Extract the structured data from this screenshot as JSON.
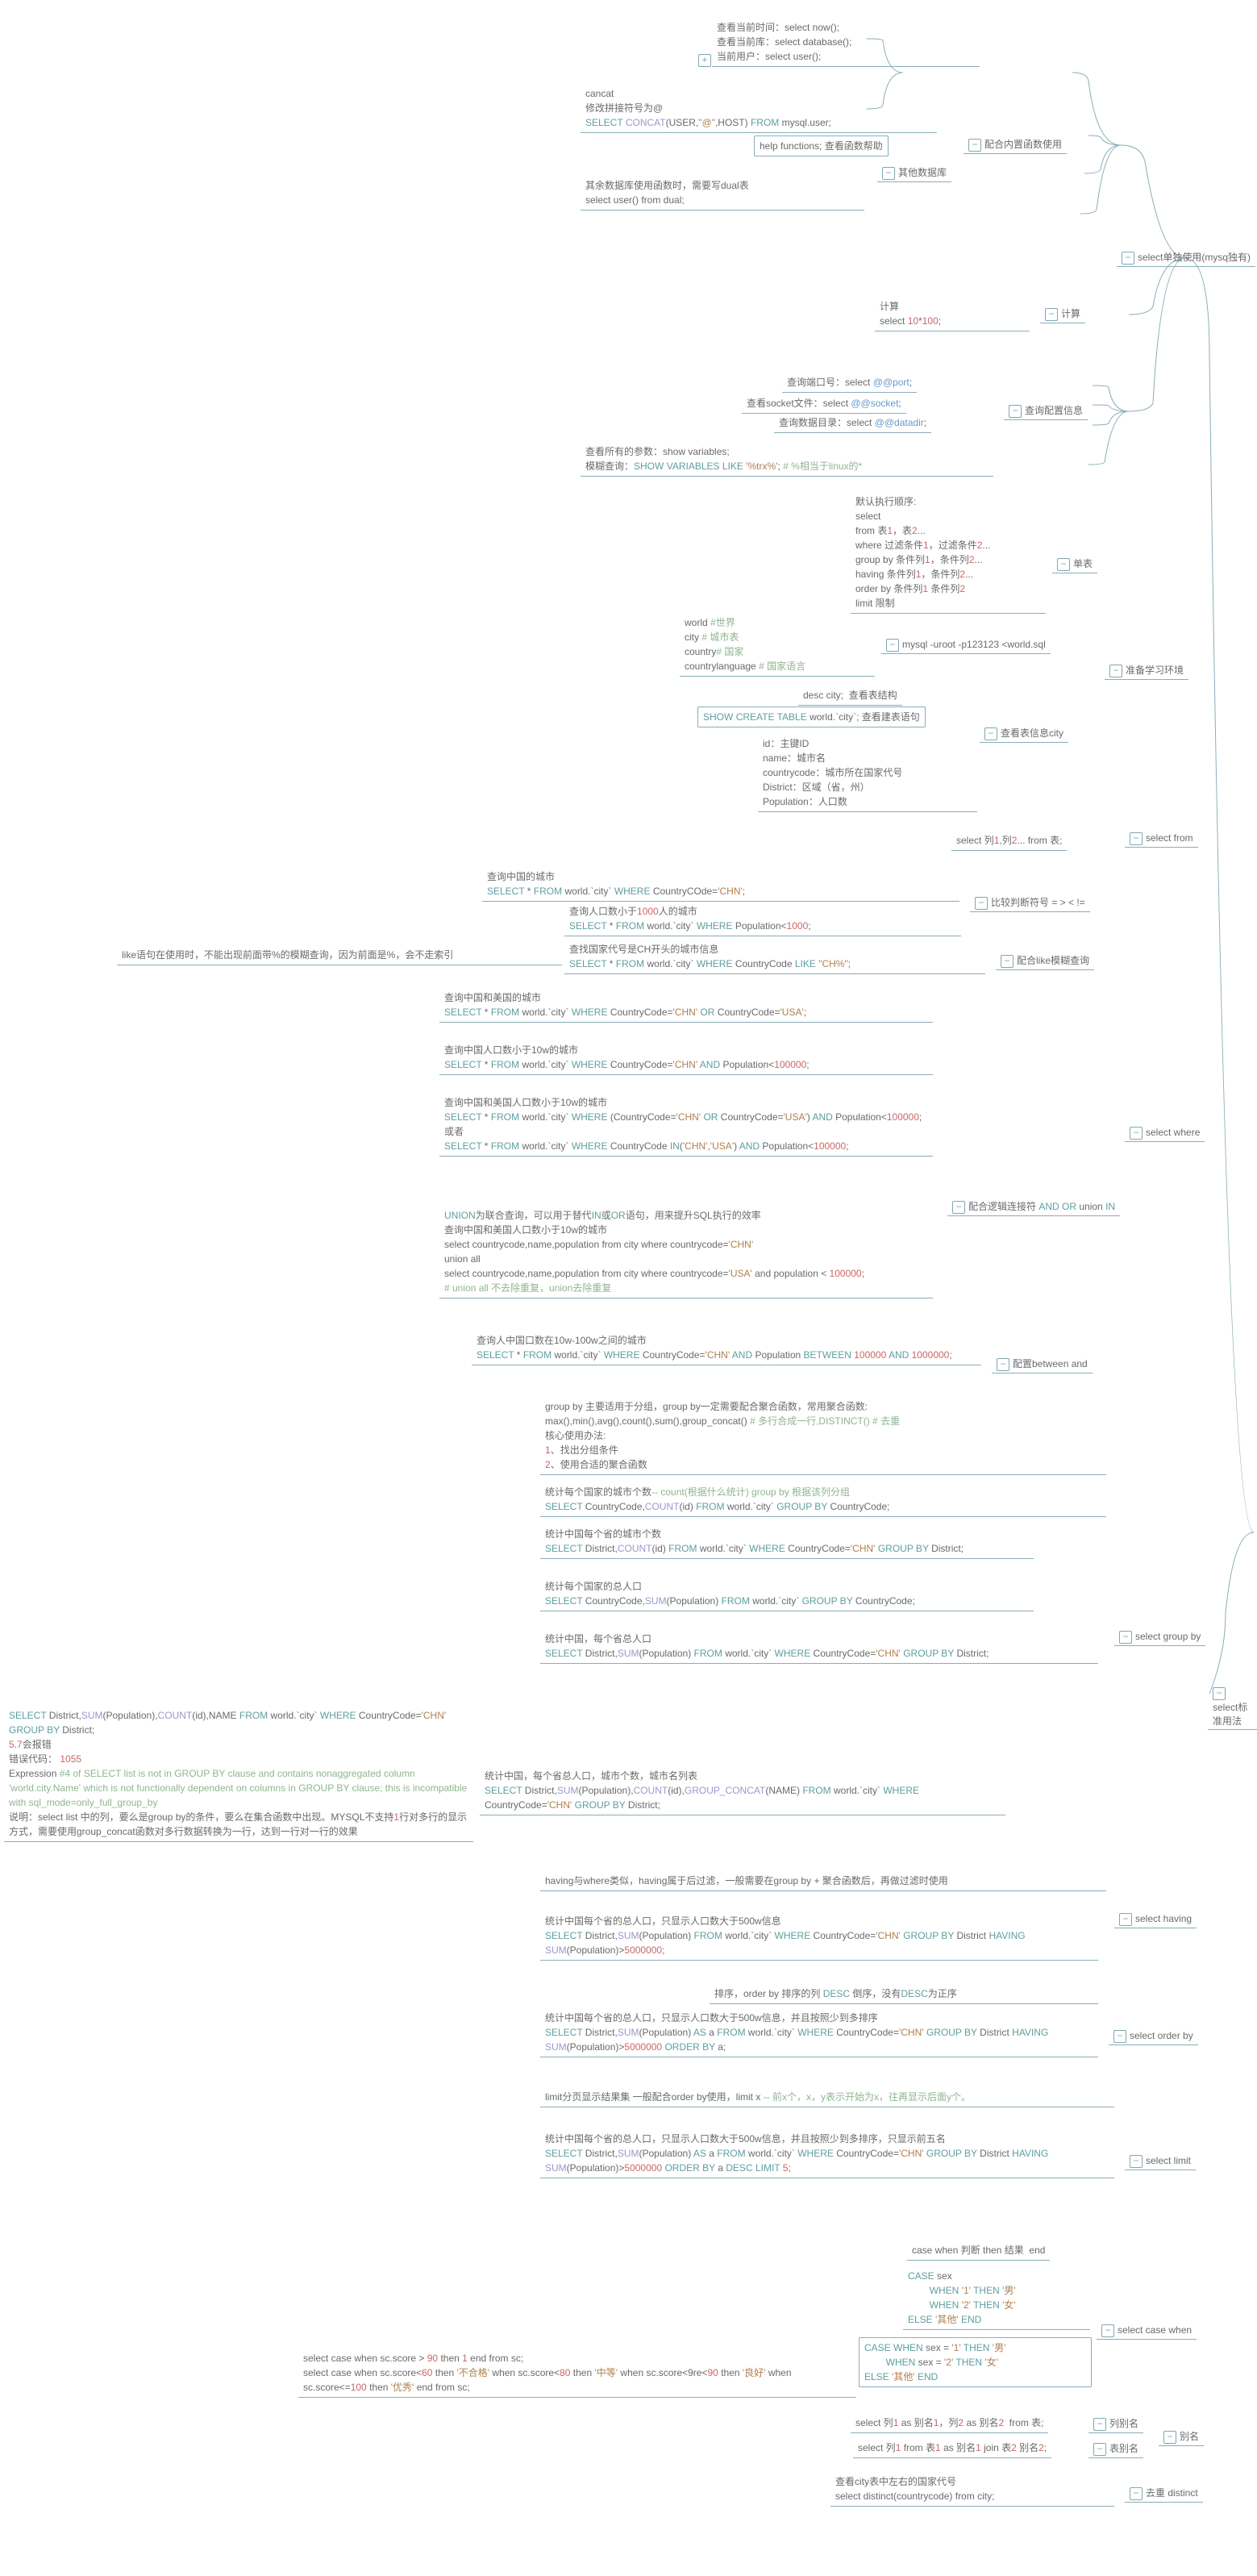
{
  "root": {
    "trunk_right": "select标准用法"
  },
  "s1": {
    "title": "select单独使用(mysq独有)",
    "builtin": {
      "label": "配合内置函数使用",
      "now": "查看当前时间：select now();\n查看当前库：select database();\n当前用户：select user();",
      "concat": "cancat\n修改拼接符号为@\nSELECT CONCAT(USER,\"@\",HOST) FROM mysql.user;",
      "help": "help functions; 查看函数帮助",
      "other_label": "其他数据库",
      "dual": "其余数据库使用函数时，需要写dual表\nselect user() from dual;"
    },
    "calc": {
      "label": "计算",
      "body": "计算\nselect 10*100;"
    },
    "cfg": {
      "label": "查询配置信息",
      "port": "查询端口号：select @@port;",
      "socket": "查看socket文件：select @@socket;",
      "datadir": "查询数据目录：select @@datadir;",
      "vars": "查看所有的参数：show variables;\n模糊查询：SHOW VARIABLES LIKE '%trx%'; # %相当于linux的*"
    }
  },
  "s2": {
    "title": "准备学习环境",
    "single": {
      "label": "单表",
      "body": "默认执行顺序:\nselect\nfrom 表1，表2...\nwhere 过滤条件1，过滤条件2...\ngroup by 条件列1，条件列2...\nhaving 条件列1，条件列2...\norder by 条件列1 条件列2\nlimit 限制"
    },
    "import": {
      "label": "mysql -uroot -p123123 <world.sql",
      "desc": "world #世界\ncity # 城市表\ncountry# 国家\ncountrylanguage # 国家语言"
    },
    "city": {
      "label": "查看表信息city",
      "desc": "desc city;  查看表结构",
      "show": "SHOW CREATE TABLE world.`city`; 查看建表语句",
      "cols": "id：主键ID\nname：城市名\ncountrycode：城市所在国家代号\nDistrict：区域（省，州）\nPopulation：人口数"
    }
  },
  "s3": {
    "from": {
      "label": "select from",
      "body": "select 列1,列2... from 表;"
    },
    "where": {
      "label": "select where",
      "cmp": {
        "label": "比较判断符号 = > < !=",
        "chn": "查询中国的城市\nSELECT * FROM world.`city` WHERE CountryCOde='CHN';",
        "pop": "查询人口数小于1000人的城市\nSELECT * FROM world.`city` WHERE Population<1000;"
      },
      "like": {
        "label": "配合like模糊查询",
        "body": "查找国家代号是CH开头的城市信息\nSELECT * FROM world.`city` WHERE CountryCode LIKE \"CH%\";",
        "note": "like语句在使用时，不能出现前面带%的模糊查询，因为前面是%，会不走索引"
      },
      "logic": {
        "label": "配合逻辑连接符 AND OR union IN",
        "or": "查询中国和美国的城市\nSELECT * FROM world.`city` WHERE CountryCode='CHN' OR CountryCode='USA';",
        "and": "查询中国人口数小于10w的城市\nSELECT * FROM world.`city` WHERE CountryCode='CHN' AND Population<100000;",
        "in": "查询中国和美国人口数小于10w的城市\nSELECT * FROM world.`city` WHERE (CountryCode='CHN' OR CountryCode='USA') AND Population<100000;\n或者\nSELECT * FROM world.`city` WHERE CountryCode IN('CHN','USA') AND Population<100000;",
        "union": "UNION为联合查询，可以用于替代IN或OR语句，用来提升SQL执行的效率\n查询中国和美国人口数小于10w的城市\nselect countrycode,name,population from city where countrycode='CHN'\nunion all\nselect countrycode,name,population from city where countrycode='USA' and population < 100000;\n# union all 不去除重复，union去除重复"
      },
      "between": {
        "label": "配置between and",
        "body": "查询人中国口数在10w-100w之间的城市\nSELECT * FROM world.`city` WHERE CountryCode='CHN' AND Population BETWEEN 100000 AND 1000000;"
      }
    },
    "group": {
      "label": "select group by",
      "intro": "group by 主要适用于分组，group by一定需要配合聚合函数，常用聚合函数:\nmax(),min(),avg(),count(),sum(),group_concat() # 多行合成一行,DISTINCT() # 去重\n核心使用办法:\n1、找出分组条件\n2、使用合适的聚合函数",
      "q1": "统计每个国家的城市个数-- count(根据什么统计) group by 根据该列分组\nSELECT CountryCode,COUNT(id) FROM world.`city` GROUP BY CountryCode;",
      "q2": "统计中国每个省的城市个数\nSELECT District,COUNT(id) FROM world.`city` WHERE CountryCode='CHN' GROUP BY District;",
      "q3": "统计每个国家的总人口\nSELECT CountryCode,SUM(Population) FROM world.`city` GROUP BY CountryCode;",
      "q4": "统计中国，每个省总人口\nSELECT District,SUM(Population) FROM world.`city` WHERE CountryCode='CHN' GROUP BY District;",
      "q5": "统计中国，每个省总人口，城市个数，城市名列表\nSELECT District,SUM(Population),COUNT(id),GROUP_CONCAT(NAME) FROM world.`city` WHERE CountryCode='CHN' GROUP BY District;",
      "err": "SELECT District,SUM(Population),COUNT(id),NAME FROM world.`city` WHERE CountryCode='CHN' GROUP BY District;\n5.7会报错\n错误代码： 1055\nExpression #4 of SELECT list is not in GROUP BY clause and contains nonaggregated column 'world.city.Name' which is not functionally dependent on columns in GROUP BY clause; this is incompatible with sql_mode=only_full_group_by\n说明：select list 中的列，要么是group by的条件，要么在集合函数中出现。MYSQL不支持1行对多行的显示方式，需要使用group_concat函数对多行数据转换为一行，达到一行对一行的效果"
    },
    "having": {
      "label": "select having",
      "intro": "having与where类似，having属于后过滤，一般需要在group by + 聚合函数后，再做过滤时使用",
      "body": "统计中国每个省的总人口，只显示人口数大于500w信息\nSELECT District,SUM(Population) FROM world.`city` WHERE CountryCode='CHN' GROUP BY District HAVING SUM(Population)>5000000;"
    },
    "orderby": {
      "label": "select order by",
      "intro": "排序，order by 排序的列 DESC 倒序，没有DESC为正序",
      "body": "统计中国每个省的总人口，只显示人口数大于500w信息，并且按照少到多排序\nSELECT District,SUM(Population) AS a FROM world.`city` WHERE CountryCode='CHN' GROUP BY District HAVING SUM(Population)>5000000 ORDER BY a;"
    },
    "limit": {
      "label": "select limit",
      "intro": "limit分页显示结果集 一般配合order by使用，limit x -- 前x个，x，y表示开始为x，往再显示后面y个。",
      "body": "统计中国每个省的总人口，只显示人口数大于500w信息，并且按照少到多排序，只显示前五名\nSELECT District,SUM(Population) AS a FROM world.`city` WHERE CountryCode='CHN' GROUP BY District HAVING SUM(Population)>5000000 ORDER BY a DESC LIMIT 5;"
    },
    "case": {
      "label": "select case when",
      "r1": "case when 判断 then 结果  end",
      "r2": "CASE sex\n        WHEN '1' THEN '男'\n        WHEN '2' THEN '女'\nELSE '其他' END",
      "r3": "CASE WHEN sex = '1' THEN '男'\n        WHEN sex = '2' THEN '女'\nELSE '其他' END",
      "r4": "select case when sc.score > 90 then 1 end from sc;\nselect case when sc.score<60 then '不合格' when sc.score<80 then '中等' when sc.score<9re<90 then '良好' when sc.score<=100 then '优秀' end from sc;"
    },
    "alias": {
      "label": "别名",
      "col": {
        "label": "列别名",
        "body": "select 列1 as 别名1，列2 as 别名2  from 表;"
      },
      "tbl": {
        "label": "表别名",
        "body": "select 列1 from 表1 as 别名1 join 表2 别名2;"
      }
    },
    "distinct": {
      "label": "去重 distinct",
      "body": "查看city表中左右的国家代号\nselect distinct(countrycode) from city;"
    }
  }
}
